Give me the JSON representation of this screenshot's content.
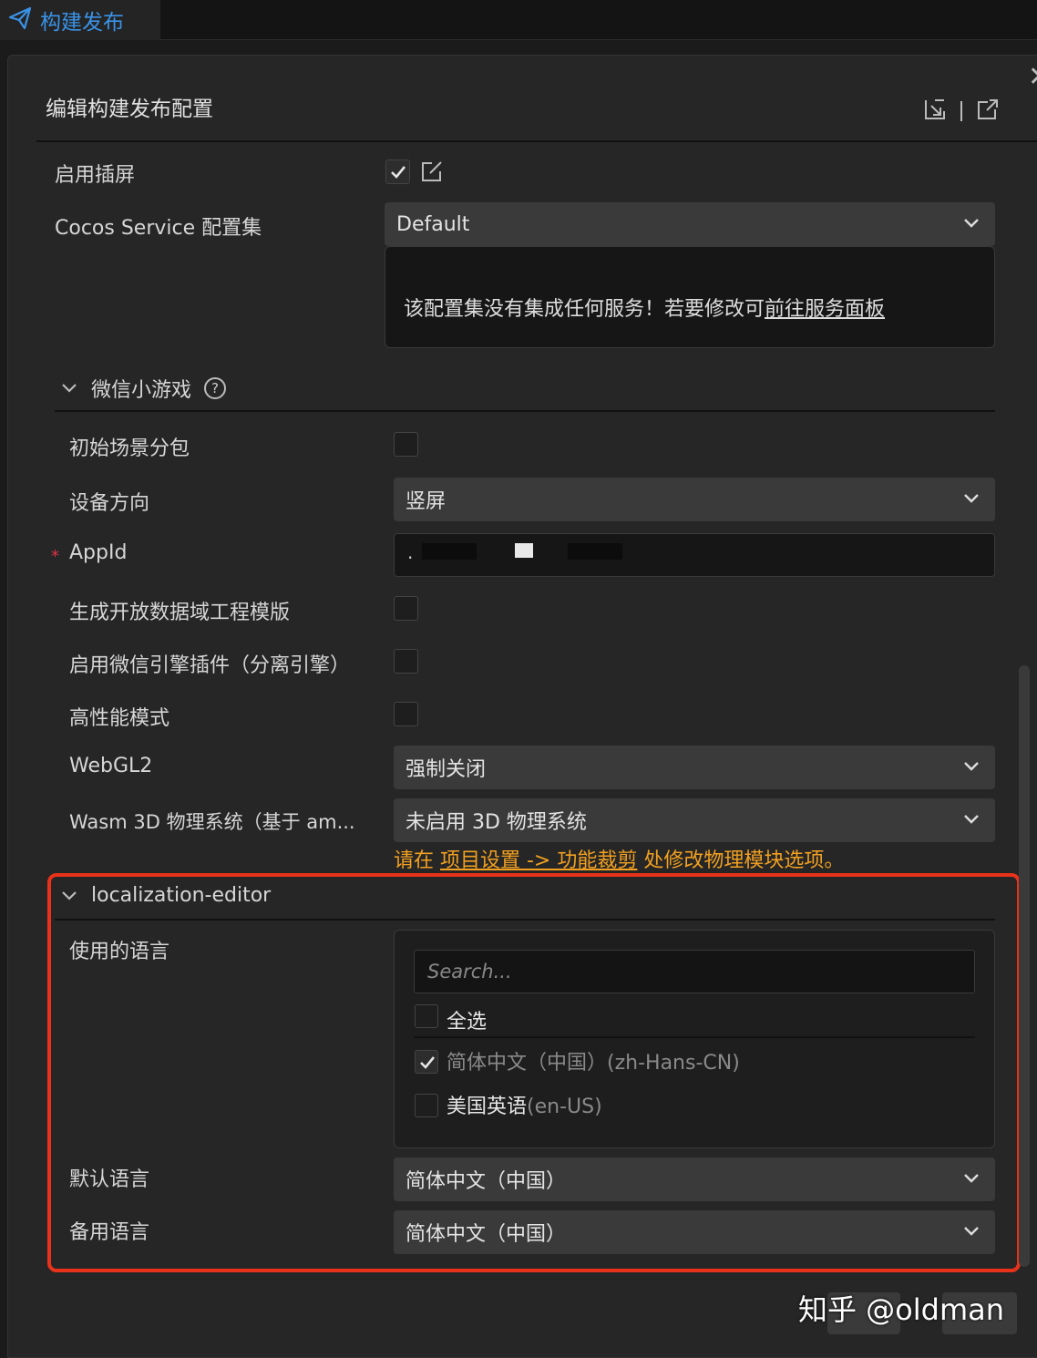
{
  "tab": {
    "label": "构建发布",
    "icon": "send-icon"
  },
  "panel": {
    "title": "编辑构建发布配置",
    "close_icon": "close-icon"
  },
  "rows_top": {
    "interstitial_label": "启用插屏",
    "service_label": "Cocos Service 配置集",
    "service_value": "Default",
    "info_text": "该配置集没有集成任何服务！若要修改可",
    "info_link": "前往服务面板"
  },
  "wechat": {
    "title": "微信小游戏",
    "initial_scene_label": "初始场景分包",
    "orientation_label": "设备方向",
    "orientation_value": "竖屏",
    "appid_label": "AppId",
    "appid_value": ".",
    "open_data_label": "生成开放数据域工程模版",
    "engine_plugin_label": "启用微信引擎插件（分离引擎）",
    "high_perf_label": "高性能模式",
    "webgl2_label": "WebGL2",
    "webgl2_value": "强制关闭",
    "wasm_label": "Wasm 3D 物理系统（基于 am...",
    "wasm_value": "未启用 3D 物理系统",
    "hint_prefix": "请在 ",
    "hint_link": "项目设置 -> 功能裁剪",
    "hint_suffix": " 处修改物理模块选项。"
  },
  "localization": {
    "title": "localization-editor",
    "languages_label": "使用的语言",
    "search_placeholder": "Search...",
    "select_all": "全选",
    "options": [
      {
        "name": "简体中文（中国）",
        "code": "(zh-Hans-CN)",
        "checked": true
      },
      {
        "name": "美国英语",
        "code": "(en-US)",
        "checked": false
      }
    ],
    "default_label": "默认语言",
    "default_value": "简体中文（中国）",
    "fallback_label": "备用语言",
    "fallback_value": "简体中文（中国）"
  },
  "watermark": "知乎 @oldman",
  "colors": {
    "accent": "#3a93e8",
    "highlight": "#e8321a",
    "hint": "#f2a020",
    "background": "#262626"
  }
}
